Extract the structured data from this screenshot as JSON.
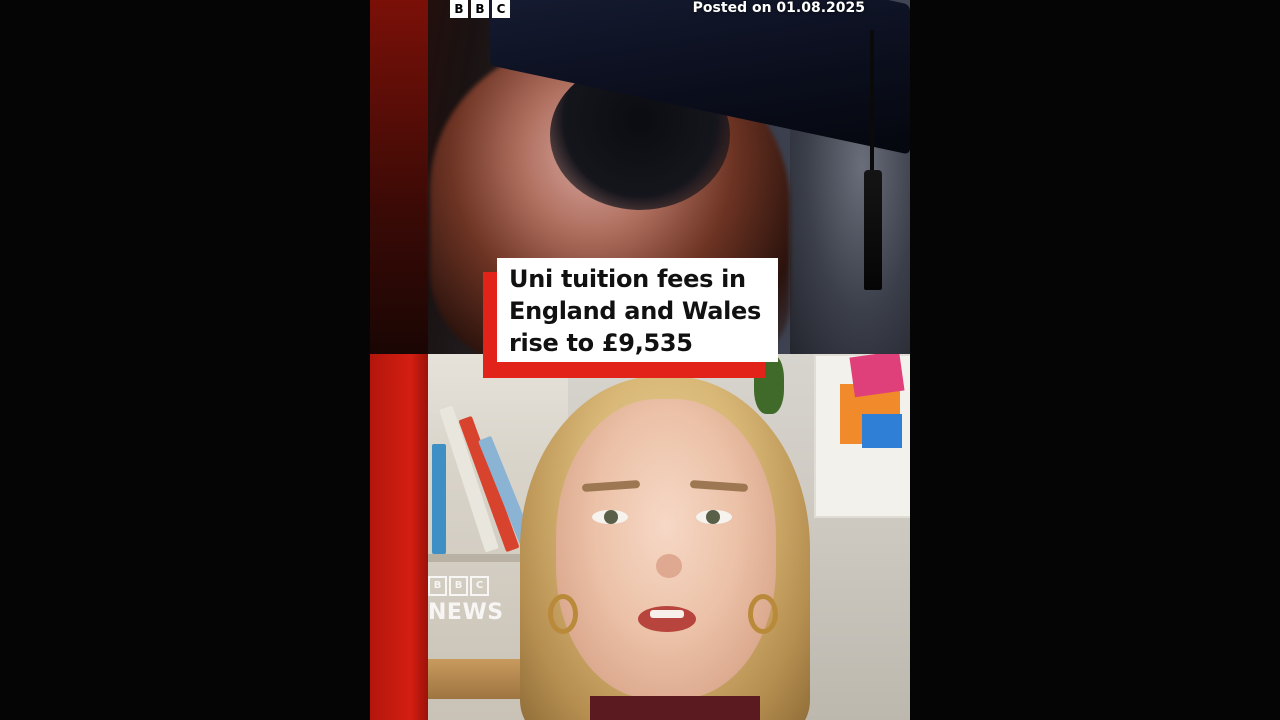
{
  "video": {
    "brand_letters": [
      "B",
      "B",
      "C"
    ],
    "posted_text": "Posted on 01.08.2025",
    "headline_lines": [
      "Uni tuition fees in",
      "England and Wales",
      "rise to £9,535"
    ],
    "watermark": {
      "letters": [
        "B",
        "B",
        "C"
      ],
      "news": "NEWS"
    }
  },
  "colors": {
    "brand_red": "#e2231a",
    "headline_bg": "#ffffff",
    "page_bg": "#000000"
  }
}
